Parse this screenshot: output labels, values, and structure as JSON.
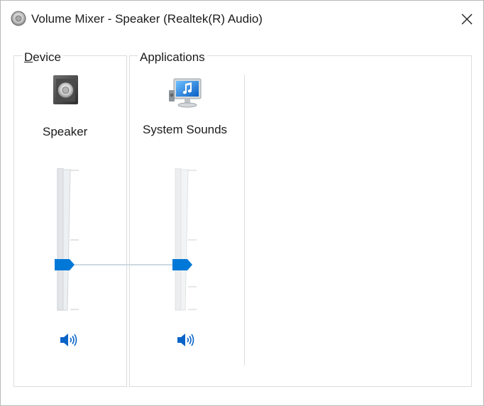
{
  "window": {
    "title": "Volume Mixer - Speaker (Realtek(R) Audio)",
    "icon": "speaker-app-icon",
    "close_icon": "close-icon"
  },
  "device": {
    "group_label_access_key": "D",
    "group_label_rest": "evice",
    "name": "Speaker",
    "icon": "speaker-device-icon",
    "volume": 0.33,
    "mute_icon": "speaker-volume-icon"
  },
  "applications": {
    "group_label": "Applications",
    "items": [
      {
        "name": "System Sounds",
        "icon": "system-sounds-icon",
        "volume": 0.33,
        "mute_icon": "speaker-volume-icon"
      }
    ]
  },
  "colors": {
    "accent": "#0078d7",
    "slider_track": "#e6e8ea",
    "border": "#dcdcdc",
    "text": "#1b1b1b"
  }
}
